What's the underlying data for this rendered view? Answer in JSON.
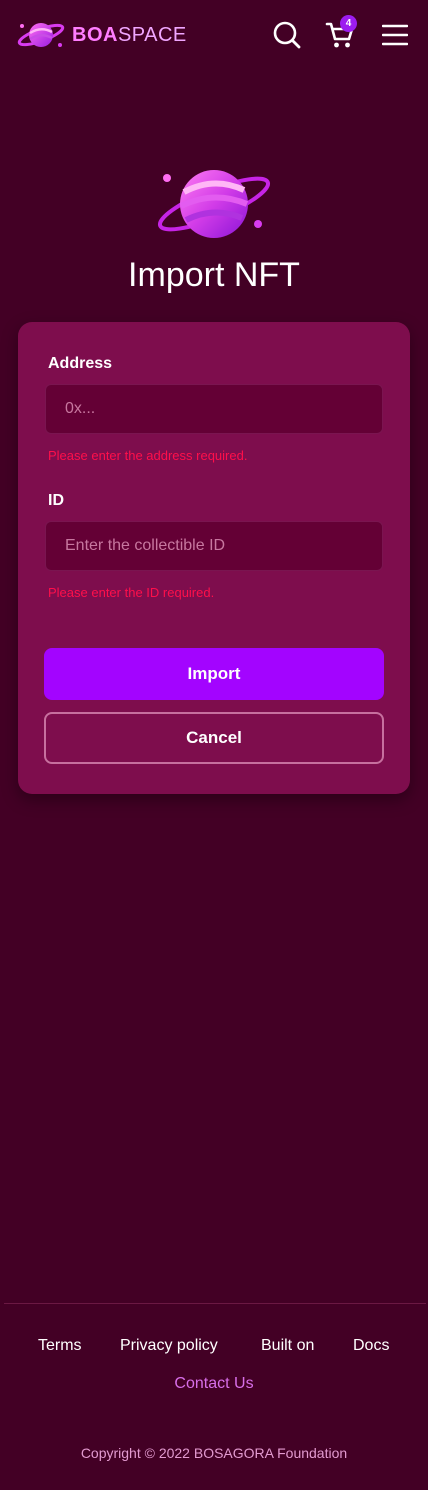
{
  "header": {
    "logo_bold": "BOA",
    "logo_light": "SPACE",
    "cart_count": "4",
    "icons": [
      "logo-planet-icon",
      "search-icon",
      "cart-icon",
      "menu-icon"
    ]
  },
  "main": {
    "title": "Import NFT",
    "hero_icon": "planet-icon"
  },
  "form": {
    "address_label": "Address",
    "address_placeholder": "0x...",
    "address_value": "",
    "address_error": "Please enter the address required.",
    "id_label": "ID",
    "id_placeholder": "Enter the collectible ID",
    "id_value": "",
    "id_error": "Please enter the ID required.",
    "import_label": "Import",
    "cancel_label": "Cancel"
  },
  "footer": {
    "links": [
      "Terms",
      "Privacy policy",
      "Built on",
      "Docs"
    ],
    "contact": "Contact Us",
    "copyright": "Copyright © 2022 BOSAGORA Foundation"
  },
  "colors": {
    "background": "#430025",
    "card": "#7e0d4d",
    "primary_button": "#a304ff",
    "error": "#ff0f4b",
    "accent_link": "#d76ee8"
  }
}
